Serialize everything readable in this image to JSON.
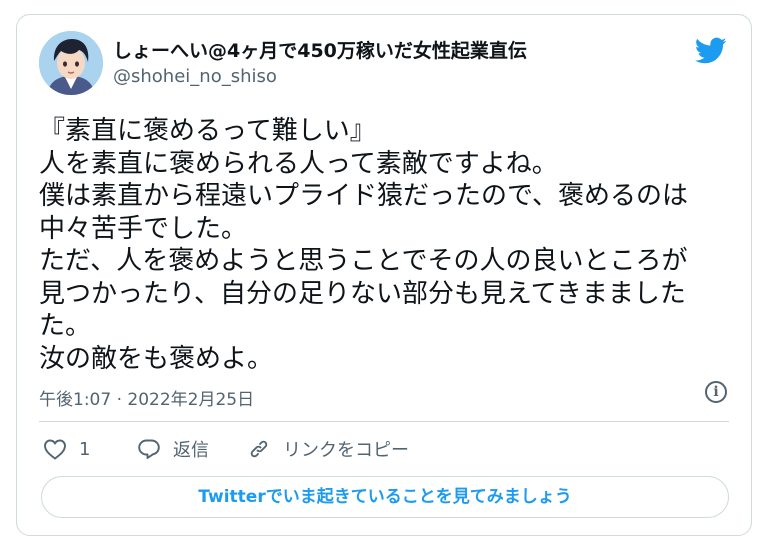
{
  "author": {
    "display_name": "しょーへい@4ヶ月で450万稼いだ女性起業直伝",
    "handle": "@shohei_no_shiso",
    "avatar_icon": "avatar-illustration-icon"
  },
  "brand": {
    "icon": "twitter-bird-icon",
    "color": "#1d9bf0"
  },
  "tweet": {
    "lines": [
      "『素直に褒めるって難しい』",
      "人を素直に褒められる人って素敵ですよね。",
      "僕は素直から程遠いプライド猿だったので、褒めるのは",
      "中々苦手でした。",
      "ただ、人を褒めようと思うことでその人の良いところが",
      "見つかったり、自分の足りない部分も見えてきまました",
      "た。",
      "汝の敵をも褒めよ。"
    ],
    "timestamp": "午後1:07 · 2022年2月25日",
    "info_icon": "info-icon"
  },
  "actions": {
    "like_count": "1",
    "like_icon": "heart-icon",
    "reply_label": "返信",
    "reply_icon": "reply-bubble-icon",
    "copy_link_label": "リンクをコピー",
    "copy_link_icon": "link-icon"
  },
  "cta": {
    "label": "Twitterでいま起きていることを見てみましょう"
  }
}
